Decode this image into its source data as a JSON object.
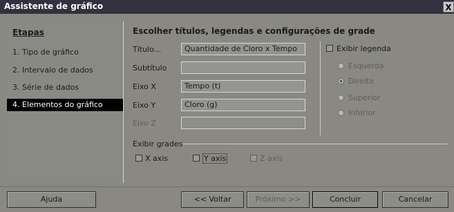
{
  "window": {
    "title": "Assistente de gráfico",
    "close_glyph": "X"
  },
  "steps": {
    "heading": "Etapas",
    "items": [
      {
        "label": "1. Tipo de gráfico"
      },
      {
        "label": "2. Intervalo de dados"
      },
      {
        "label": "3. Série de dados"
      },
      {
        "label": "4. Elementos do gráfico"
      }
    ],
    "active_index": 3
  },
  "main": {
    "section_title": "Escolher títulos, legendas e configurações de grade",
    "fields": {
      "title": {
        "label": "Título...",
        "value": "Quantidade de Cloro x Tempo"
      },
      "subtitle": {
        "label": "Subtítulo",
        "value": ""
      },
      "x_axis": {
        "label": "Eixo X",
        "value": "Tempo (t)"
      },
      "y_axis": {
        "label": "Eixo Y",
        "value": "Cloro (g)"
      },
      "z_axis": {
        "label": "Eixo Z",
        "value": ""
      }
    },
    "legend": {
      "toggle_label": "Exibir legenda",
      "checked": false,
      "positions": [
        {
          "label": "Esquerda",
          "selected": false
        },
        {
          "label": "Direita",
          "selected": true
        },
        {
          "label": "Superior",
          "selected": false
        },
        {
          "label": "Inferior",
          "selected": false
        }
      ]
    },
    "grids": {
      "label": "Exibir grades",
      "x_axis": {
        "label": "X axis",
        "checked": false
      },
      "y_axis": {
        "label": "Y axis",
        "checked": false
      },
      "z_axis": {
        "label": "Z axis",
        "checked": false
      }
    }
  },
  "buttons": {
    "help": "Ajuda",
    "back": "<< Voltar",
    "next": "Próximo >>",
    "finish": "Concluir",
    "cancel": "Cancelar"
  }
}
